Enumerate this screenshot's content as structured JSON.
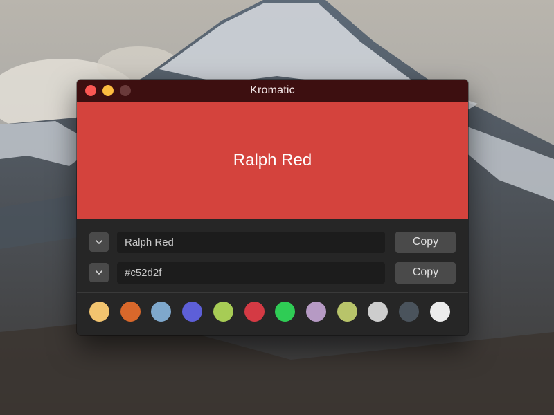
{
  "window": {
    "title": "Kromatic"
  },
  "swatch": {
    "name": "Ralph Red",
    "color": "#d4433d"
  },
  "fields": [
    {
      "value": "Ralph Red",
      "button": "Copy",
      "dropdown_icon": "chevron-down-icon"
    },
    {
      "value": "#c52d2f",
      "button": "Copy",
      "dropdown_icon": "chevron-down-icon"
    }
  ],
  "palette": [
    {
      "name": "yellow",
      "color": "#f2c46f"
    },
    {
      "name": "orange",
      "color": "#d9682b"
    },
    {
      "name": "light-blue",
      "color": "#7fa8cc"
    },
    {
      "name": "indigo",
      "color": "#5d5fd8"
    },
    {
      "name": "lime",
      "color": "#a7cc55"
    },
    {
      "name": "red",
      "color": "#d43a44"
    },
    {
      "name": "green",
      "color": "#2fcc55"
    },
    {
      "name": "lavender",
      "color": "#b69ac4"
    },
    {
      "name": "olive",
      "color": "#b8c46a"
    },
    {
      "name": "light-gray",
      "color": "#cdcdcd"
    },
    {
      "name": "slate",
      "color": "#4a535c"
    },
    {
      "name": "white",
      "color": "#ececec"
    }
  ]
}
